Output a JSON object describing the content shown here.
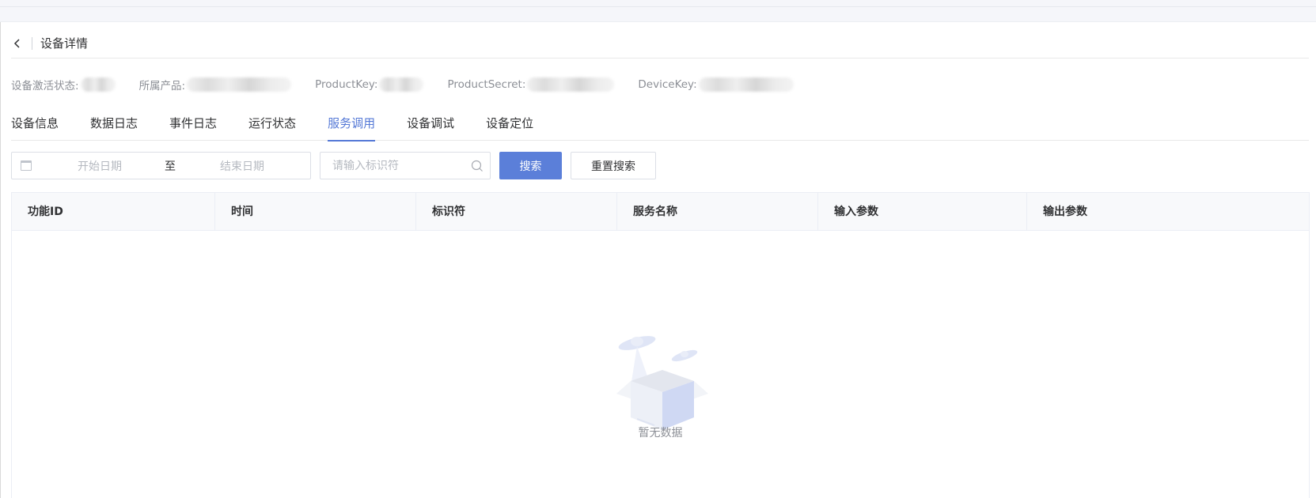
{
  "header": {
    "title": "设备详情"
  },
  "info": [
    {
      "label": "设备激活状态:",
      "blur_width": 44
    },
    {
      "label": "所属产品:",
      "blur_width": 132
    },
    {
      "label": "ProductKey:",
      "blur_width": 60
    },
    {
      "label": "ProductSecret:",
      "blur_width": 120
    },
    {
      "label": "DeviceKey:",
      "blur_width": 130
    }
  ],
  "tabs": [
    {
      "label": "设备信息",
      "active": false
    },
    {
      "label": "数据日志",
      "active": false
    },
    {
      "label": "事件日志",
      "active": false
    },
    {
      "label": "运行状态",
      "active": false
    },
    {
      "label": "服务调用",
      "active": true
    },
    {
      "label": "设备调试",
      "active": false
    },
    {
      "label": "设备定位",
      "active": false
    }
  ],
  "filters": {
    "start_placeholder": "开始日期",
    "range_separator": "至",
    "end_placeholder": "结束日期",
    "identifier_placeholder": "请输入标识符",
    "search_label": "搜索",
    "reset_label": "重置搜索"
  },
  "table": {
    "columns": [
      "功能ID",
      "时间",
      "标识符",
      "服务名称",
      "输入参数",
      "输出参数"
    ],
    "empty_text": "暂无数据"
  },
  "colors": {
    "accent": "#5478d6",
    "primary_button": "#5b7fd9"
  }
}
